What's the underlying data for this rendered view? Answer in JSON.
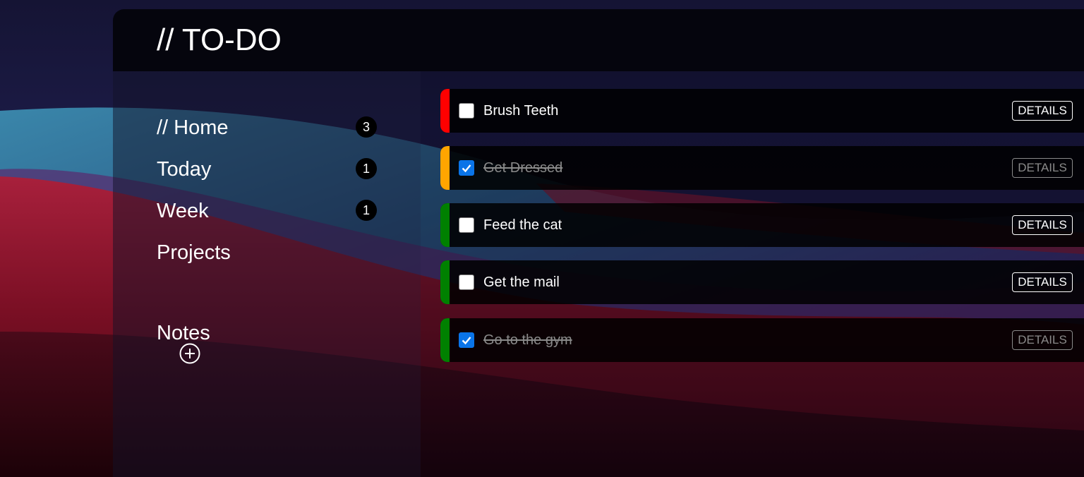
{
  "app": {
    "title": "// TO-DO"
  },
  "sidebar": {
    "items": [
      {
        "label": "// Home",
        "count": "3"
      },
      {
        "label": "Today",
        "count": "1"
      },
      {
        "label": "Week",
        "count": "1"
      },
      {
        "label": "Projects"
      },
      {
        "label": "Notes"
      }
    ],
    "add_project_icon": "plus-circle-icon"
  },
  "tasks": [
    {
      "title": "Brush Teeth",
      "done": false,
      "priority_color": "#ff0000",
      "details_label": "DETAILS"
    },
    {
      "title": "Get Dressed",
      "done": true,
      "priority_color": "#ffa500",
      "details_label": "DETAILS"
    },
    {
      "title": "Feed the cat",
      "done": false,
      "priority_color": "#008000",
      "details_label": "DETAILS"
    },
    {
      "title": "Get the mail",
      "done": false,
      "priority_color": "#008000",
      "details_label": "DETAILS"
    },
    {
      "title": "Go to the gym",
      "done": true,
      "priority_color": "#008000",
      "details_label": "DETAILS"
    }
  ]
}
